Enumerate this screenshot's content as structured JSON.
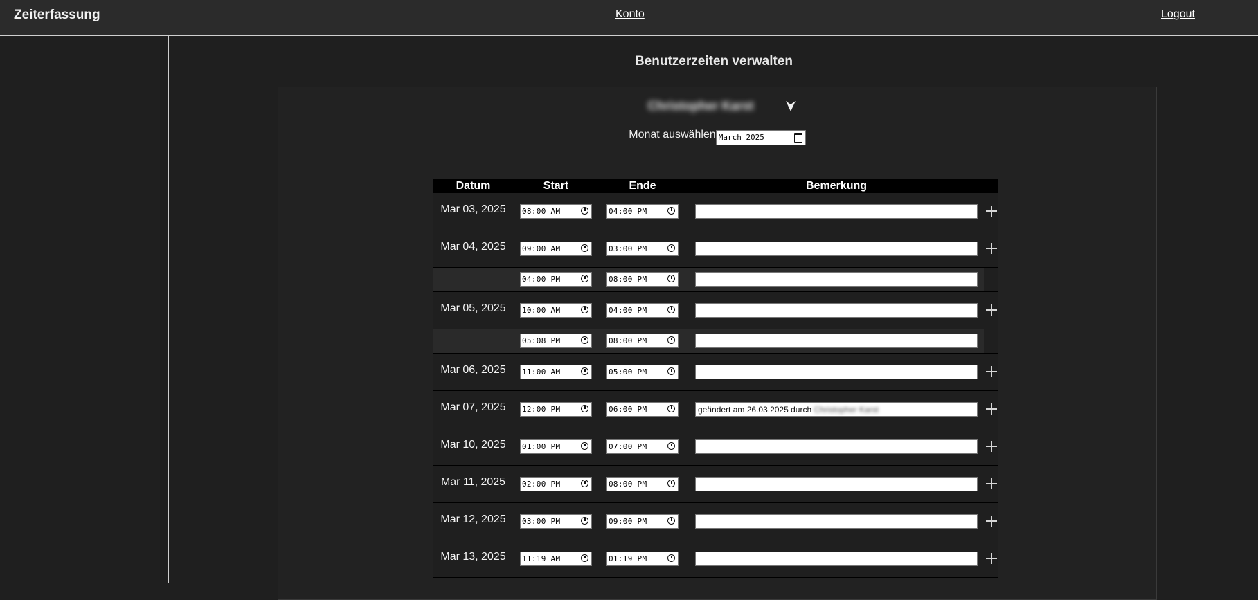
{
  "header": {
    "brand": "Zeiterfassung",
    "account_link": "Konto",
    "logout_link": "Logout"
  },
  "page": {
    "title": "Benutzerzeiten verwalten",
    "user_name": "Christopher Karst",
    "month_label": "Monat auswählen",
    "month_value": "March  2025"
  },
  "table": {
    "headers": {
      "date": "Datum",
      "start": "Start",
      "end": "Ende",
      "note": "Bemerkung"
    },
    "rows": [
      {
        "date": "Mar 03, 2025",
        "start": "08:00 AM",
        "end": "04:00 PM",
        "note": ""
      },
      {
        "date": "Mar 04, 2025",
        "start": "09:00 AM",
        "end": "03:00 PM",
        "note": ""
      },
      {
        "date": "",
        "start": "04:00 PM",
        "end": "08:00 PM",
        "note": ""
      },
      {
        "date": "Mar 05, 2025",
        "start": "10:00 AM",
        "end": "04:00 PM",
        "note": ""
      },
      {
        "date": "",
        "start": "05:08 PM",
        "end": "08:00 PM",
        "note": ""
      },
      {
        "date": "Mar 06, 2025",
        "start": "11:00 AM",
        "end": "05:00 PM",
        "note": ""
      },
      {
        "date": "Mar 07, 2025",
        "start": "12:00 PM",
        "end": "06:00 PM",
        "note": "geändert am 26.03.2025 durch",
        "note_user": "Christopher Karst"
      },
      {
        "date": "Mar 10, 2025",
        "start": "01:00 PM",
        "end": "07:00 PM",
        "note": ""
      },
      {
        "date": "Mar 11, 2025",
        "start": "02:00 PM",
        "end": "08:00 PM",
        "note": ""
      },
      {
        "date": "Mar 12, 2025",
        "start": "03:00 PM",
        "end": "09:00 PM",
        "note": ""
      },
      {
        "date": "Mar 13, 2025",
        "start": "11:19 AM",
        "end": "01:19 PM",
        "note": ""
      }
    ]
  },
  "icons": {
    "add": "plus-icon",
    "time": "clock-icon",
    "calendar": "calendar-icon",
    "dropdown": "dropdown-arrow-icon"
  },
  "colors": {
    "background": "#1f1f1f",
    "topbar": "#2b2b2b",
    "header_row": "#000000",
    "sub_row": "#2a2a2a"
  }
}
